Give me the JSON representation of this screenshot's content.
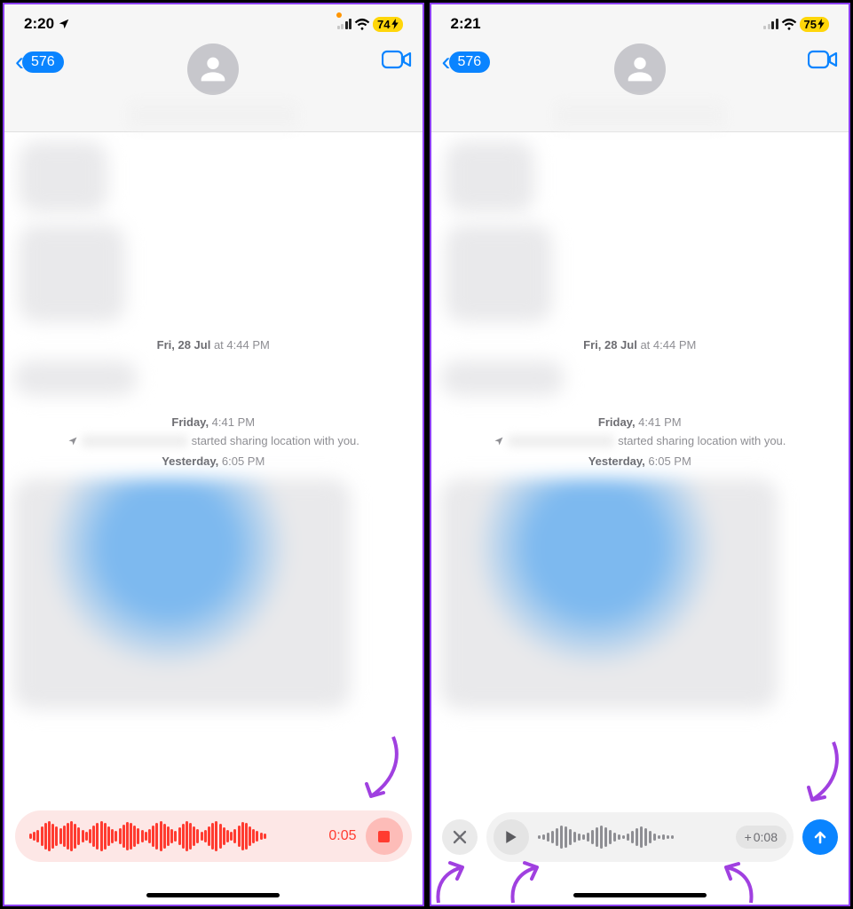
{
  "left": {
    "status": {
      "time": "2:20",
      "battery": "74",
      "battery_charging": true,
      "signal_active_bars": 2
    },
    "nav": {
      "unread": "576"
    },
    "chat": {
      "ts1_prefix": "Fri, 28 Jul",
      "ts1_at": " at ",
      "ts1_time": "4:44 PM",
      "ts2_prefix": "Friday,",
      "ts2_time": " 4:41 PM",
      "location_text": "started sharing location with you.",
      "ts3_prefix": "Yesterday,",
      "ts3_time": " 6:05 PM"
    },
    "compose": {
      "rec_time": "0:05"
    }
  },
  "right": {
    "status": {
      "time": "2:21",
      "battery": "75",
      "battery_charging": true,
      "signal_active_bars": 2
    },
    "nav": {
      "unread": "576"
    },
    "chat": {
      "ts1_prefix": "Fri, 28 Jul",
      "ts1_at": " at ",
      "ts1_time": "4:44 PM",
      "ts2_prefix": "Friday,",
      "ts2_time": " 4:41 PM",
      "location_text": "started sharing location with you.",
      "ts3_prefix": "Yesterday,",
      "ts3_time": " 6:05 PM"
    },
    "compose": {
      "keep_prefix": "+ ",
      "keep_time": "0:08"
    }
  }
}
